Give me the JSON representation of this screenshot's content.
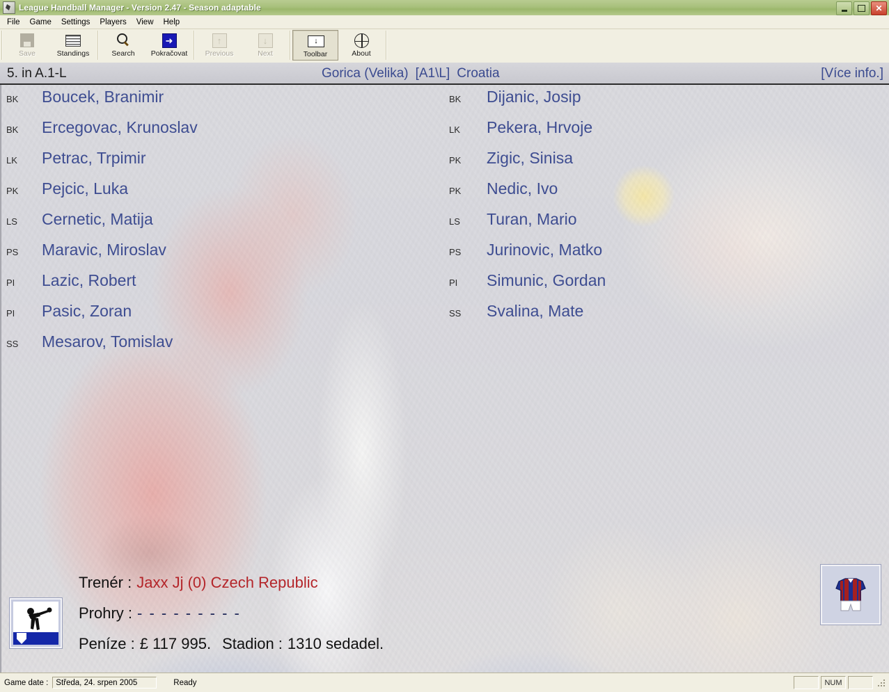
{
  "window": {
    "title": "League Handball Manager  - Version 2.47  - Season adaptable",
    "icon": "app-icon",
    "minimize_label": "",
    "maximize_label": "",
    "close_label": "✕"
  },
  "menubar": {
    "items": [
      "File",
      "Game",
      "Settings",
      "Players",
      "View",
      "Help"
    ]
  },
  "toolbar": {
    "buttons": [
      {
        "label": "Save",
        "icon": "save-icon",
        "enabled": false,
        "pressed": false
      },
      {
        "label": "Standings",
        "icon": "standings-icon",
        "enabled": true,
        "pressed": false
      },
      {
        "label": "Search",
        "icon": "search-icon",
        "enabled": true,
        "pressed": false
      },
      {
        "label": "Pokračovat",
        "icon": "next-arrow-icon",
        "enabled": true,
        "pressed": false
      },
      {
        "label": "Previous",
        "icon": "arrow-up-icon",
        "enabled": false,
        "pressed": false
      },
      {
        "label": "Next",
        "icon": "arrow-down-icon",
        "enabled": false,
        "pressed": false
      },
      {
        "label": "Toolbar",
        "icon": "toolbar-icon",
        "enabled": true,
        "pressed": true
      },
      {
        "label": "About",
        "icon": "globe-icon",
        "enabled": true,
        "pressed": false
      }
    ]
  },
  "team_header": {
    "rank": "5. in A.1-L",
    "team_name": "Gorica (Velika)",
    "league_code": "[A1\\L]",
    "country": "Croatia",
    "more_info": "[Více info.]"
  },
  "roster": {
    "left": [
      {
        "pos": "BK",
        "name": "Boucek, Branimir"
      },
      {
        "pos": "BK",
        "name": "Ercegovac, Krunoslav"
      },
      {
        "pos": "LK",
        "name": "Petrac, Trpimir"
      },
      {
        "pos": "PK",
        "name": "Pejcic, Luka"
      },
      {
        "pos": "LS",
        "name": "Cernetic, Matija"
      },
      {
        "pos": "PS",
        "name": "Maravic, Miroslav"
      },
      {
        "pos": "PI",
        "name": "Lazic, Robert"
      },
      {
        "pos": "PI",
        "name": "Pasic, Zoran"
      },
      {
        "pos": "SS",
        "name": "Mesarov, Tomislav"
      }
    ],
    "right": [
      {
        "pos": "BK",
        "name": "Dijanic, Josip"
      },
      {
        "pos": "LK",
        "name": "Pekera, Hrvoje"
      },
      {
        "pos": "PK",
        "name": "Zigic, Sinisa"
      },
      {
        "pos": "PK",
        "name": "Nedic, Ivo"
      },
      {
        "pos": "LS",
        "name": "Turan, Mario"
      },
      {
        "pos": "PS",
        "name": "Jurinovic, Matko"
      },
      {
        "pos": "PI",
        "name": "Simunic, Gordan"
      },
      {
        "pos": "SS",
        "name": "Svalina, Mate"
      }
    ]
  },
  "club_info": {
    "coach_label": "Trenér :",
    "coach_value": "Jaxx Jj (0) Czech Republic",
    "losses_label": "Prohry :",
    "losses_value": "- - - - - - - - -",
    "money_label": "Peníze :",
    "money_value": "£ 117 995.",
    "stadium_label": "Stadion :",
    "stadium_value": "1310 sedadel.",
    "club_badge_icon": "handball-player-badge-icon",
    "jersey_icon": "team-jersey-icon"
  },
  "statusbar": {
    "game_date_label": "Game date :",
    "game_date_value": "Středa, 24. srpen 2005",
    "ready_text": "Ready",
    "indicator_blank": "",
    "indicator_num": "NUM",
    "indicator_blank2": ""
  },
  "colors": {
    "title_bar": "#a8c07c",
    "accent_link": "#3e4d91",
    "coach_red": "#b4252a",
    "toolbar_bg": "#f1efe2",
    "content_bg": "#cfcfd4"
  }
}
